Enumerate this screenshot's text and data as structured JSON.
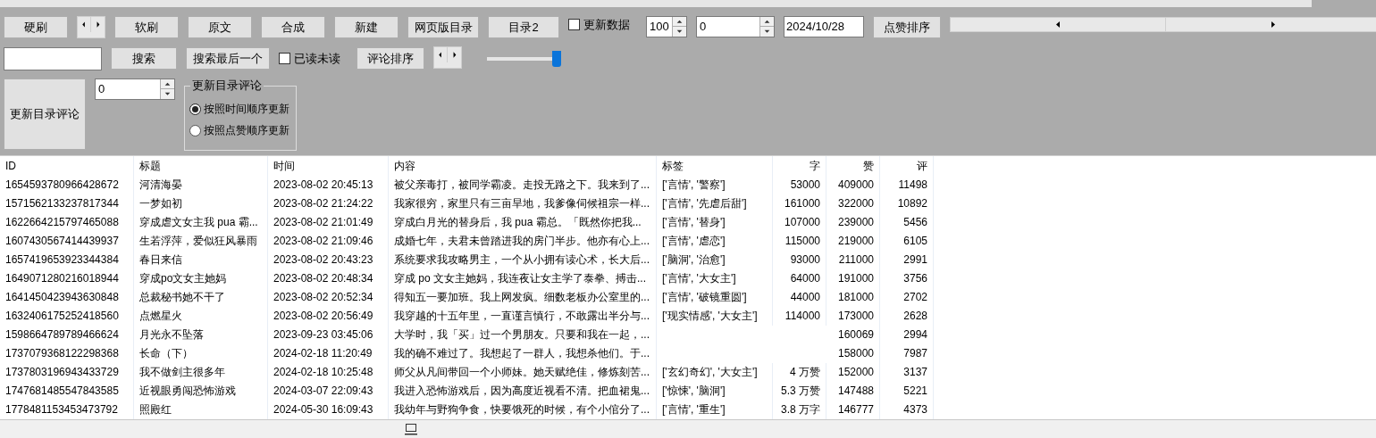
{
  "toolbar_row1": {
    "buttons": [
      "硬刷",
      "软刷",
      "原文",
      "合成",
      "新建",
      "网页版目录",
      "目录2"
    ],
    "update_data": {
      "label": "更新数据",
      "checked": false
    },
    "spinner_a": "100",
    "spinner_b": "0",
    "date": "2024/10/28",
    "sort_likes": "点赞排序"
  },
  "toolbar_row2": {
    "search_button": "搜索",
    "search_last_button": "搜索最后一个",
    "read_unread": {
      "label": "已读未读",
      "checked": false
    },
    "sort_comments": "评论排序",
    "slider": {
      "level": 0.95
    }
  },
  "update_panel": {
    "button": "更新目录评论",
    "spinner": "0",
    "group": {
      "title": "更新目录评论",
      "options": [
        {
          "label": "按照时间顺序更新",
          "selected": true
        },
        {
          "label": "按照点赞顺序更新",
          "selected": false
        }
      ]
    }
  },
  "table": {
    "columns": [
      "ID",
      "标题",
      "时间",
      "内容",
      "标签",
      "字",
      "赞",
      "评"
    ],
    "rows": [
      [
        "1654593780966428672",
        "河清海晏",
        "2023-08-02 20:45:13",
        "被父亲毒打，被同学霸凌。走投无路之下。我来到了...",
        "['言情', '警察']",
        "53000",
        "409000",
        "11498"
      ],
      [
        "1571562133237817344",
        "一梦如初",
        "2023-08-02 21:24:22",
        "我家很穷，家里只有三亩旱地，我爹像伺候祖宗一样...",
        "['言情', '先虐后甜']",
        "161000",
        "322000",
        "10892"
      ],
      [
        "1622664215797465088",
        "穿成虐文女主我 pua 霸...",
        "2023-08-02 21:01:49",
        "穿成白月光的替身后，我 pua 霸总。「既然你把我...",
        "['言情', '替身']",
        "107000",
        "239000",
        "5456"
      ],
      [
        "1607430567414439937",
        "生若浮萍，爱似狂风暴雨",
        "2023-08-02 21:09:46",
        "成婚七年，夫君未曾踏进我的房门半步。他亦有心上...",
        "['言情', '虐恋']",
        "115000",
        "219000",
        "6105"
      ],
      [
        "1657419653923344384",
        "春日来信",
        "2023-08-02 20:43:23",
        "系统要求我攻略男主，一个从小拥有读心术，长大后...",
        "['脑洞', '治愈']",
        "93000",
        "211000",
        "2991"
      ],
      [
        "1649071280216018944",
        "穿成po文女主她妈",
        "2023-08-02 20:48:34",
        "穿成 po 文女主她妈，我连夜让女主学了泰拳、搏击...",
        "['言情', '大女主']",
        "64000",
        "191000",
        "3756"
      ],
      [
        "1641450423943630848",
        "总裁秘书她不干了",
        "2023-08-02 20:52:34",
        "得知五一要加班。我上网发疯。细数老板办公室里的...",
        "['言情', '破镜重圆']",
        "44000",
        "181000",
        "2702"
      ],
      [
        "1632406175252418560",
        "点燃星火",
        "2023-08-02 20:56:49",
        "我穿越的十五年里，一直谨言慎行，不敢露出半分与...",
        "['现实情感', '大女主']",
        "114000",
        "173000",
        "2628"
      ],
      [
        "1598664789789466624",
        "月光永不坠落",
        "2023-09-23 03:45:06",
        "大学时，我「买」过一个男朋友。只要和我在一起，...",
        "",
        "",
        "160069",
        "2994"
      ],
      [
        "1737079368122298368",
        "长命（下）",
        "2024-02-18 11:20:49",
        "我的确不难过了。我想起了一群人，我想杀他们。于...",
        "",
        "",
        "158000",
        "7987"
      ],
      [
        "1737803196943433729",
        "我不做剑主很多年",
        "2024-02-18 10:25:48",
        "师父从凡间带回一个小师妹。她天赋绝佳，修炼刻苦...",
        "['玄幻奇幻', '大女主']",
        "4 万赞",
        "152000",
        "3137"
      ],
      [
        "1747681485547843585",
        "近视眼勇闯恐怖游戏",
        "2024-03-07 22:09:43",
        "我进入恐怖游戏后，因为高度近视看不清。把血裙鬼...",
        "['惊悚', '脑洞']",
        "5.3 万赞",
        "147488",
        "5221"
      ],
      [
        "1778481153453473792",
        "照殿红",
        "2024-05-30 16:09:43",
        "我幼年与野狗争食，快要饿死的时候，有个小倌分了...",
        "['言情', '重生']",
        "3.8 万字",
        "146777",
        "4373"
      ]
    ]
  }
}
